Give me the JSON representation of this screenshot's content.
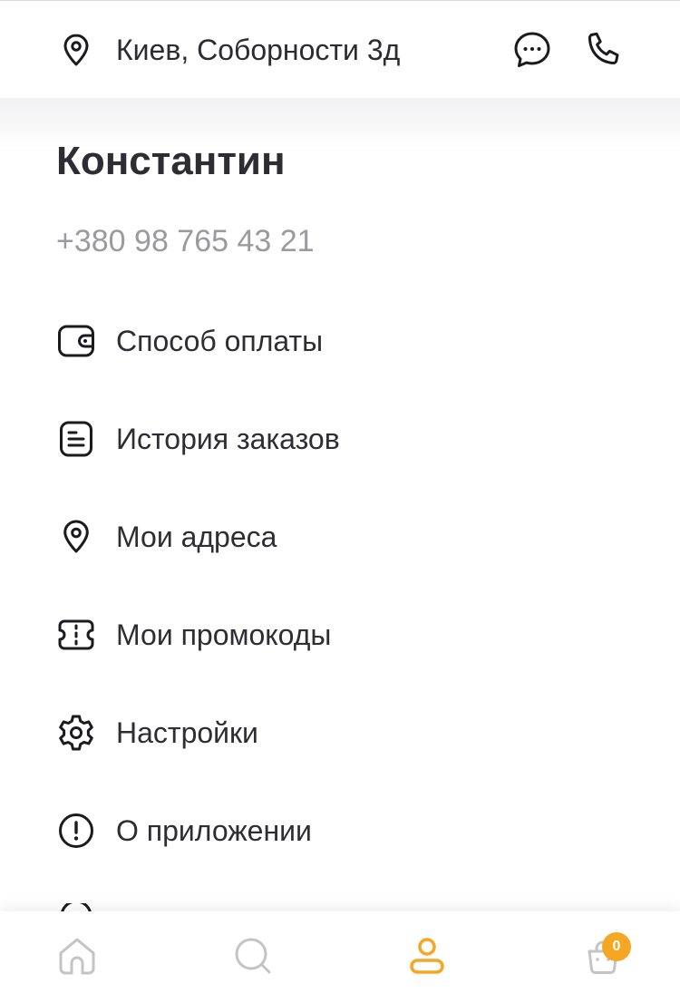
{
  "header": {
    "address": "Киев, Соборности 3д",
    "icons": {
      "location": "location-pin-icon",
      "chat": "chat-bubble-icon",
      "phone": "phone-icon"
    }
  },
  "profile": {
    "name": "Константин",
    "phone": "+380 98 765 43 21"
  },
  "menu": {
    "items": [
      {
        "label": "Способ оплаты",
        "icon": "wallet-icon"
      },
      {
        "label": "История заказов",
        "icon": "document-list-icon"
      },
      {
        "label": "Мои адреса",
        "icon": "location-pin-icon"
      },
      {
        "label": "Мои промокоды",
        "icon": "ticket-icon"
      },
      {
        "label": "Настройки",
        "icon": "gear-icon"
      },
      {
        "label": "О приложении",
        "icon": "info-exclamation-icon"
      }
    ]
  },
  "tabbar": {
    "tabs": [
      {
        "name": "home",
        "icon": "home-icon",
        "active": false
      },
      {
        "name": "search",
        "icon": "search-icon",
        "active": false
      },
      {
        "name": "profile",
        "icon": "profile-icon",
        "active": true
      },
      {
        "name": "cart",
        "icon": "cart-bag-icon",
        "active": false
      }
    ],
    "cart_count": "0"
  },
  "colors": {
    "accent": "#f5a623",
    "text": "#2e2d33",
    "muted": "#9a9a9f",
    "inactive_icon": "#c4c4c8"
  }
}
